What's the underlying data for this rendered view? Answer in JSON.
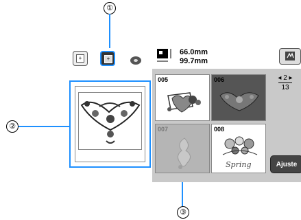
{
  "callouts": {
    "c1": "①",
    "c2": "②",
    "c3": "③"
  },
  "frame_buttons": [
    {
      "name": "frame-size-small",
      "glyph": "+"
    },
    {
      "name": "frame-size-large",
      "glyph": "+"
    }
  ],
  "embroidery_size": {
    "height": "66.0mm",
    "width": "99.7mm"
  },
  "patterns": [
    {
      "id": "005",
      "state": "normal"
    },
    {
      "id": "006",
      "state": "selected"
    },
    {
      "id": "007",
      "state": "unavailable"
    },
    {
      "id": "008",
      "state": "normal"
    }
  ],
  "pattern_008_caption": "Spring",
  "page": {
    "current": "2",
    "total": "13"
  },
  "buttons": {
    "adjust_label": "Ajuste"
  },
  "colors": {
    "highlight": "#1e90ff",
    "screen_bg": "#c9c9c9"
  }
}
